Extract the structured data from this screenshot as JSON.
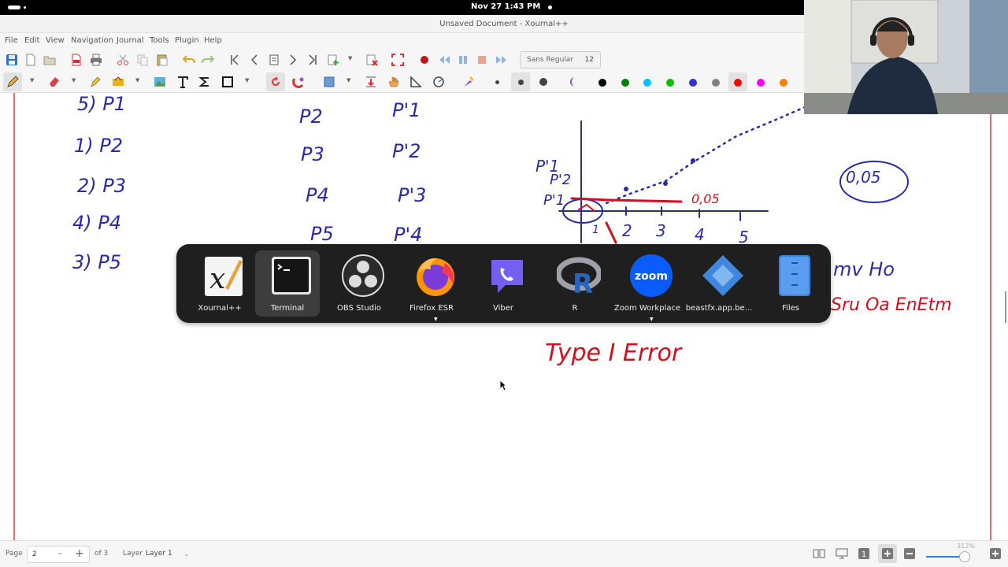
{
  "system": {
    "clock": "Nov 27  1:43 PM"
  },
  "window": {
    "title": "Unsaved Document - Xournal++"
  },
  "menu": [
    "File",
    "Edit",
    "View",
    "Navigation",
    "Journal",
    "Tools",
    "Plugin",
    "Help"
  ],
  "toolbar": {
    "font_name": "Sans Regular",
    "font_size": "12"
  },
  "pen_colors": [
    "#000000",
    "#008000",
    "#00c0ff",
    "#00c000",
    "#3333cc",
    "#808080",
    "#ff0000",
    "#ff00ff",
    "#ff8000"
  ],
  "dock": {
    "apps": [
      {
        "label": "Xournal++",
        "icon": "xournal-icon"
      },
      {
        "label": "Terminal",
        "icon": "terminal-icon"
      },
      {
        "label": "OBS Studio",
        "icon": "obs-icon"
      },
      {
        "label": "Firefox ESR",
        "icon": "firefox-icon"
      },
      {
        "label": "Viber",
        "icon": "viber-icon"
      },
      {
        "label": "R",
        "icon": "r-icon"
      },
      {
        "label": "Zoom Workplace",
        "icon": "zoom-icon",
        "icon_text": "zoom"
      },
      {
        "label": "beastfx.app.be...",
        "icon": "beastfx-icon"
      },
      {
        "label": "Files",
        "icon": "files-icon"
      }
    ]
  },
  "handwriting": {
    "left_col": [
      "5)  P1",
      "1)  P2",
      "2)  P3",
      "4)  P4",
      "3)  P5"
    ],
    "mid_col1": [
      "P2",
      "P3",
      "P4",
      "P5"
    ],
    "mid_col2": [
      "P'1",
      "P'2",
      "P'3",
      "P'4"
    ],
    "graph_labels": [
      "P'1",
      "P'2",
      "P'1"
    ],
    "graph_ticks": [
      "1",
      "2",
      "3",
      "4",
      "5"
    ],
    "alpha_red": "0,05",
    "alpha_circled": "0,05",
    "right_blue": "mv Ho",
    "right_red": "Sru Oa EnEtm",
    "type_error": "Type I Error"
  },
  "status": {
    "page_label": "Page",
    "page_value": "2",
    "of_pages": "of 3",
    "layer_label": "Layer",
    "layer_value": "Layer 1",
    "zoom": "312%"
  }
}
